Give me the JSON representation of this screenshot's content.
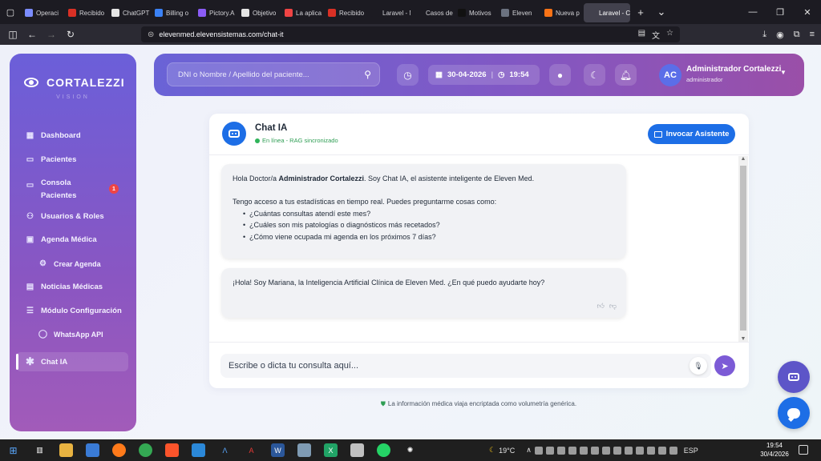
{
  "browser": {
    "tabs": [
      {
        "label": "Operaci",
        "color": "#7b8cff"
      },
      {
        "label": "Recibido",
        "color": "#d93025"
      },
      {
        "label": "ChatGPT",
        "color": "#e5e5e5"
      },
      {
        "label": "Billing o",
        "color": "#3b82f6"
      },
      {
        "label": "Pictory.A",
        "color": "#8b5cf6"
      },
      {
        "label": "Objetivo",
        "color": "#e5e5e5"
      },
      {
        "label": "La aplica",
        "color": "#ef4444"
      },
      {
        "label": "Recibido",
        "color": "#d93025"
      },
      {
        "label": "Laravel - No",
        "color": "#1c1b22"
      },
      {
        "label": "Casos de Éxi",
        "color": "#1c1b22"
      },
      {
        "label": "Motivos",
        "color": "#111"
      },
      {
        "label": "Eleven",
        "color": "#6b7280"
      },
      {
        "label": "Nueva p",
        "color": "#f97316"
      },
      {
        "label": "Laravel - C",
        "color": "#42414d"
      }
    ],
    "url": "elevenmed.elevensistemas.com/chat-it"
  },
  "sidebar": {
    "brand": "CORTALEZZI",
    "brand_sub": "VISION",
    "items": [
      {
        "label": "Dashboard",
        "icon": "grid-icon"
      },
      {
        "label": "Pacientes",
        "icon": "id-card-icon"
      },
      {
        "label": "Consola",
        "label2": "Pacientes",
        "icon": "monitor-icon",
        "badge": "1"
      },
      {
        "label": "Usuarios & Roles",
        "icon": "users-icon"
      },
      {
        "label": "Agenda Médica",
        "icon": "calendar-icon"
      },
      {
        "label": "Crear Agenda",
        "icon": "gear-icon"
      },
      {
        "label": "Noticias Médicas",
        "icon": "newspaper-icon"
      },
      {
        "label": "Módulo Configuración",
        "icon": "sliders-icon"
      },
      {
        "label": "WhatsApp API",
        "icon": "whatsapp-icon"
      },
      {
        "label": "Chat IA",
        "icon": "asterisk-icon"
      }
    ]
  },
  "header": {
    "search_placeholder": "DNI o Nombre / Apellido del paciente...",
    "date": "30-04-2026",
    "separator": "|",
    "time": "19:54",
    "user_initials": "AC",
    "user_name": "Administrador Cortalezzi",
    "user_role": "administrador"
  },
  "chat": {
    "title": "Chat IA",
    "status": "En línea - RAG sincronizado",
    "invoke_label": "Invocar Asistente",
    "messages": {
      "m1_pre": "Hola Doctor/a ",
      "m1_name": "Administrador Cortalezzi",
      "m1_post": ". Soy Chat IA, el asistente inteligente de Eleven Med.",
      "m1_line2": "Tengo acceso a tus estadísticas en tiempo real. Puedes preguntarme cosas como:",
      "m1_items": [
        "¿Cuántas consultas atendí este mes?",
        "¿Cuáles son mis patologías o diagnósticos más recetados?",
        "¿Cómo viene ocupada mi agenda en los próximos 7 días?"
      ],
      "m2": "¡Hola! Soy Mariana, la Inteligencia Artificial Clínica de Eleven Med. ¿En qué puedo ayudarte hoy?"
    },
    "input_placeholder": "Escribe o dicta tu consulta aquí..."
  },
  "footer_note": "La información médica viaja encriptada como volumetría genérica.",
  "taskbar": {
    "weather": "19°C",
    "lang": "ESP",
    "time": "19:54",
    "date": "30/4/2026"
  },
  "colors": {
    "accent": "#1d6ee6",
    "sidebar_top": "#6b5fd9",
    "sidebar_bottom": "#a25bb9",
    "online": "#2fb45a"
  }
}
